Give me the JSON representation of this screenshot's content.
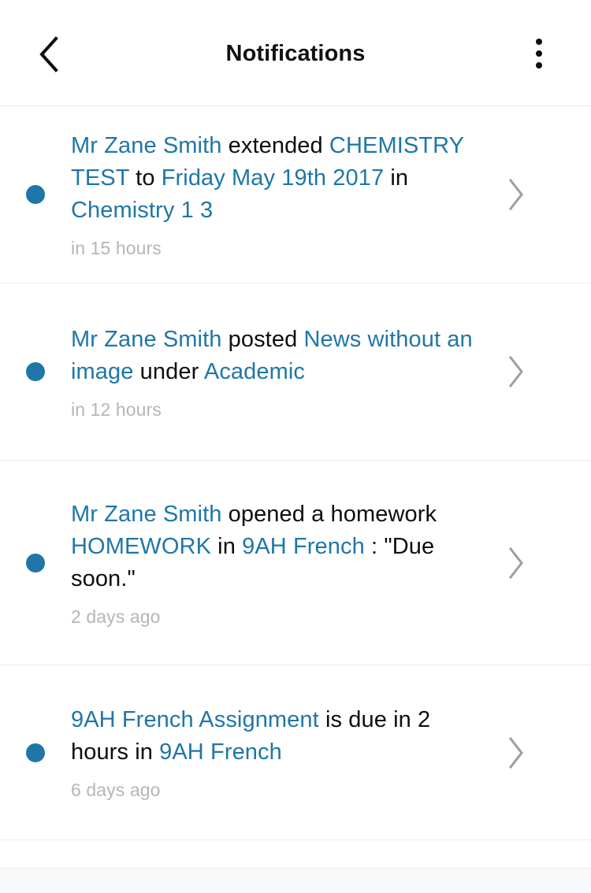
{
  "header": {
    "title": "Notifications",
    "back_icon": "chevron-left-icon",
    "overflow_icon": "more-vertical-icon"
  },
  "colors": {
    "link": "#1f76a8",
    "unread_dot": "#1f76a8",
    "text": "#0d0d0d",
    "timestamp": "#b3b6b8",
    "divider": "#ececec",
    "bottom_strip": "#f7f8fa",
    "chevron": "#9e9e9e"
  },
  "notifications": [
    {
      "id": 1,
      "unread": true,
      "timestamp": "in 15 hours",
      "chevron_icon": "chevron-right-icon",
      "segments": [
        {
          "text": "Mr Zane Smith",
          "link": true
        },
        {
          "text": " extended ",
          "link": false
        },
        {
          "text": "CHEMISTRY TEST",
          "link": true
        },
        {
          "text": " to ",
          "link": false
        },
        {
          "text": "Friday May 19th 2017",
          "link": true
        },
        {
          "text": " in ",
          "link": false
        },
        {
          "text": "Chemistry 1 3",
          "link": true
        }
      ]
    },
    {
      "id": 2,
      "unread": true,
      "timestamp": "in 12 hours",
      "chevron_icon": "chevron-right-icon",
      "segments": [
        {
          "text": "Mr Zane Smith",
          "link": true
        },
        {
          "text": " posted ",
          "link": false
        },
        {
          "text": "News without an image",
          "link": true
        },
        {
          "text": " under ",
          "link": false
        },
        {
          "text": "Academic",
          "link": true
        }
      ]
    },
    {
      "id": 3,
      "unread": true,
      "timestamp": "2 days ago",
      "chevron_icon": "chevron-right-icon",
      "segments": [
        {
          "text": "Mr Zane Smith",
          "link": true
        },
        {
          "text": " opened a homework ",
          "link": false
        },
        {
          "text": "HOMEWORK",
          "link": true
        },
        {
          "text": " in ",
          "link": false
        },
        {
          "text": "9AH French",
          "link": true
        },
        {
          "text": " : \"Due soon.\"",
          "link": false
        }
      ]
    },
    {
      "id": 4,
      "unread": true,
      "timestamp": "6 days ago",
      "chevron_icon": "chevron-right-icon",
      "segments": [
        {
          "text": "9AH French Assignment",
          "link": true
        },
        {
          "text": " is due in 2 hours in ",
          "link": false
        },
        {
          "text": "9AH French",
          "link": true
        }
      ]
    }
  ]
}
